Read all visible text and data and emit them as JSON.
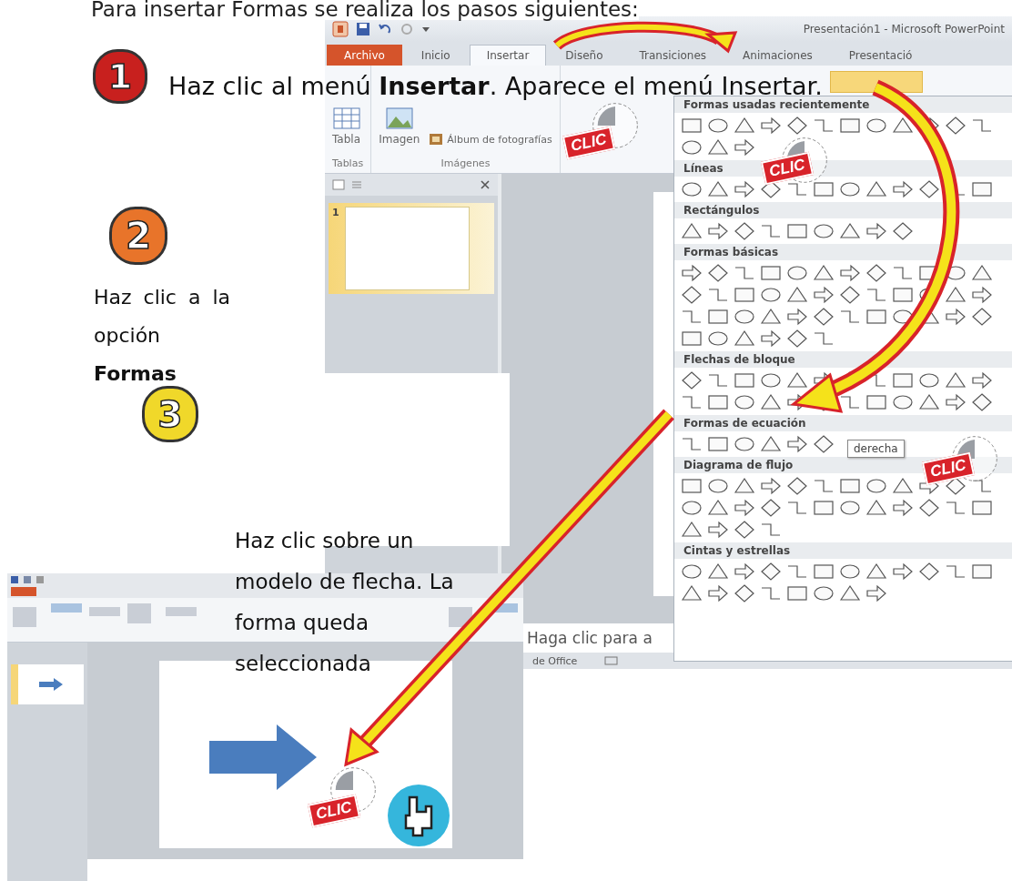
{
  "heading": "Para insertar Formas se realiza los pasos siguientes:",
  "steps": [
    {
      "badge": "1",
      "color": "#c8201e",
      "text": "Haz clic al menú **Insertar**. Aparece el menú Insertar."
    },
    {
      "badge": "2",
      "color": "#e8742a",
      "text": "Haz clic a la opción **Formas**"
    },
    {
      "badge": "3",
      "color": "#f0d82a",
      "text": "Haz clic sobre un modelo de flecha. La forma queda seleccionada"
    }
  ],
  "powerpoint_window": {
    "title": "Presentación1 - Microsoft PowerPoint",
    "tabs": [
      {
        "label": "Archivo",
        "kind": "file",
        "selected": false
      },
      {
        "label": "Inicio",
        "kind": "tab",
        "selected": false
      },
      {
        "label": "Insertar",
        "kind": "tab",
        "selected": true
      },
      {
        "label": "Diseño",
        "kind": "tab",
        "selected": false
      },
      {
        "label": "Transiciones",
        "kind": "tab",
        "selected": false
      },
      {
        "label": "Animaciones",
        "kind": "tab",
        "selected": false
      },
      {
        "label": "Presentació",
        "kind": "tab",
        "selected": false
      }
    ],
    "ribbon_groups": [
      {
        "label": "Tablas",
        "buttons": [
          {
            "label": "Tabla",
            "kind": "large"
          }
        ]
      },
      {
        "label": "Imágenes",
        "buttons": [
          {
            "label": "Imagen",
            "kind": "large"
          },
          {
            "label": "Álbum de fotografías",
            "kind": "small"
          }
        ]
      }
    ],
    "shapes_gallery": {
      "sections": [
        "Formas usadas recientemente",
        "Líneas",
        "Rectángulos",
        "Formas básicas",
        "Flechas de bloque",
        "Formas de ecuación",
        "Diagrama de flujo",
        "Cintas y estrellas"
      ],
      "tooltip": "derecha"
    },
    "slides": [
      {
        "number": "1",
        "selected": true
      }
    ],
    "notes_placeholder": "Haga clic para a",
    "status_text": "de Office"
  },
  "result_window": {
    "slides": [
      {
        "selected": true
      }
    ]
  },
  "clic_stamps": [
    {
      "label": "CLIC"
    },
    {
      "label": "CLIC"
    },
    {
      "label": "CLIC"
    },
    {
      "label": "CLIC"
    }
  ]
}
